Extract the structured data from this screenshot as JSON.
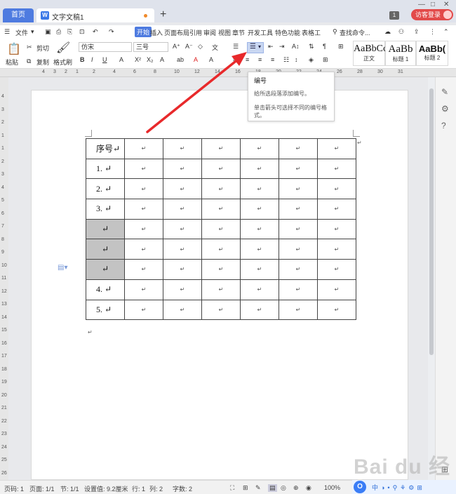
{
  "tabs": {
    "home": "首页",
    "doc_icon": "W",
    "doc_name": "文字文稿1",
    "new": "+"
  },
  "window": {
    "min": "—",
    "max": "□",
    "close": "✕",
    "badge": "1",
    "visitor": "访客登录"
  },
  "menu": {
    "file": "文件",
    "start": "开始",
    "items": [
      "插入",
      "页面布局",
      "引用",
      "审阅",
      "视图",
      "章节",
      "开发工具",
      "特色功能",
      "表格工"
    ],
    "search": "查找命令..."
  },
  "ribbon": {
    "paste": "粘贴",
    "cut": "剪切",
    "copy": "复制",
    "format_painter": "格式刷",
    "font_name": "仿宋",
    "font_size": "三号",
    "style_normal": "正文",
    "style_h1": "标题 1",
    "style_h2": "标题 2",
    "style_sample_normal": "AaBbCc",
    "style_sample_h1": "AaBb",
    "style_sample_h2": "AaBb("
  },
  "ruler": {
    "h_ticks": [
      "4",
      "3",
      "2",
      "1",
      "2",
      "4",
      "6",
      "8",
      "10",
      "12",
      "14",
      "16",
      "18",
      "20",
      "22",
      "24",
      "26",
      "28",
      "30",
      "31"
    ],
    "v_ticks": [
      "4",
      "3",
      "2",
      "1",
      "1",
      "2",
      "3",
      "4",
      "5",
      "6",
      "7",
      "8",
      "9",
      "10",
      "11",
      "12",
      "13",
      "14",
      "15",
      "16",
      "17",
      "18",
      "19",
      "20",
      "21",
      "22",
      "23",
      "24",
      "25",
      "26"
    ]
  },
  "tooltip": {
    "title": "编号",
    "desc": "给所选段落添加编号。",
    "hint": "单击箭头可选择不同的编号格式。"
  },
  "table": {
    "rows": [
      {
        "first": "序号↵",
        "shaded": false
      },
      {
        "first": "1. ↵",
        "shaded": false
      },
      {
        "first": "2. ↵",
        "shaded": false
      },
      {
        "first": "3. ↵",
        "shaded": false
      },
      {
        "first": "↵",
        "shaded": true
      },
      {
        "first": "↵",
        "shaded": true
      },
      {
        "first": "↵",
        "shaded": true
      },
      {
        "first": "4. ↵",
        "shaded": false
      },
      {
        "first": "5. ↵",
        "shaded": false
      }
    ],
    "cell_mark": "↵",
    "columns": 7
  },
  "status": {
    "page_num": "页码: 1",
    "pages": "页面: 1/1",
    "section": "节: 1/1",
    "setting": "设置值: 9.2厘米",
    "row": "行: 1",
    "col": "列: 2",
    "words": "字数: 2",
    "zoom": "100%"
  },
  "watermark": "Bai du 经验",
  "colors": {
    "accent": "#4e7be0",
    "arrow": "#e8292b",
    "visitor": "#e24a4a",
    "shaded": "#c3c3c3"
  }
}
